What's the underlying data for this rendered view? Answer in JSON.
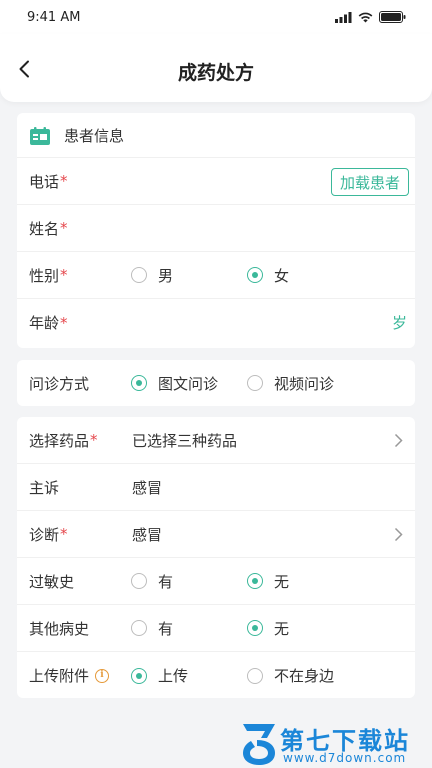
{
  "status_bar": {
    "time": "9:41 AM"
  },
  "nav": {
    "title": "成药处方"
  },
  "patient": {
    "section_title": "患者信息",
    "phone_label": "电话",
    "load_button": "加载患者",
    "name_label": "姓名",
    "gender_label": "性别",
    "gender_options": [
      "男",
      "女"
    ],
    "gender_selected": "女",
    "age_label": "年龄",
    "age_suffix": "岁"
  },
  "consult": {
    "label": "问诊方式",
    "options": [
      "图文问诊",
      "视频问诊"
    ],
    "selected": "图文问诊"
  },
  "prescription": {
    "drug_label": "选择药品",
    "drug_value": "已选择三种药品",
    "complaint_label": "主诉",
    "complaint_value": "感冒",
    "diagnosis_label": "诊断",
    "diagnosis_value": "感冒",
    "allergy_label": "过敏史",
    "allergy_options": [
      "有",
      "无"
    ],
    "allergy_selected": "无",
    "history_label": "其他病史",
    "history_options": [
      "有",
      "无"
    ],
    "history_selected": "无",
    "attach_label": "上传附件",
    "attach_options": [
      "上传",
      "不在身边"
    ],
    "attach_selected": "上传"
  },
  "required_mark": "*",
  "info_glyph": "i",
  "watermark": {
    "title": "第七下载站",
    "url": "www.d7down.com"
  },
  "colors": {
    "accent": "#3bb89a",
    "required": "#e5484d",
    "info": "#e59a3a",
    "watermark": "#1b86d8"
  }
}
